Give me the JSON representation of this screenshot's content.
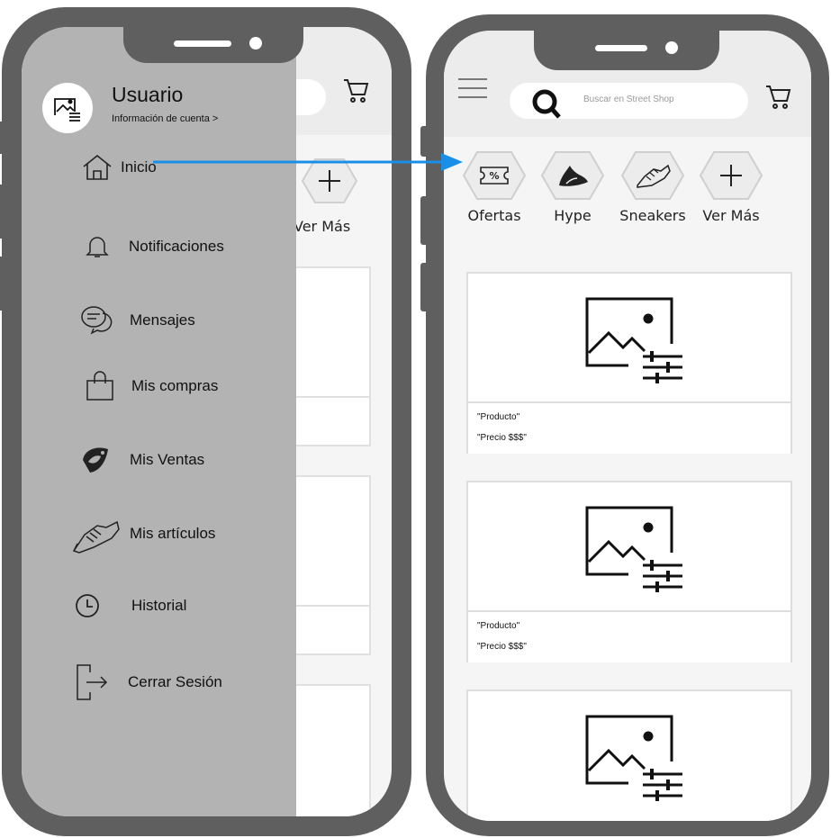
{
  "drawer": {
    "user_name": "Usuario",
    "account_link": "Información de cuenta >",
    "items": [
      {
        "label": "Inicio",
        "icon": "home-icon"
      },
      {
        "label": "Notificaciones",
        "icon": "bell-icon"
      },
      {
        "label": "Mensajes",
        "icon": "chat-icon"
      },
      {
        "label": "Mis compras",
        "icon": "shopping-bag-icon"
      },
      {
        "label": "Mis Ventas",
        "icon": "sales-tag-icon"
      },
      {
        "label": "Mis artículos",
        "icon": "sneaker-icon"
      },
      {
        "label": "Historial",
        "icon": "clock-icon"
      },
      {
        "label": "Cerrar Sesión",
        "icon": "logout-icon"
      }
    ]
  },
  "background_peek": {
    "ver_mas": "Ver Más"
  },
  "home": {
    "search": {
      "placeholder": "Buscar en Street Shop"
    },
    "categories": [
      {
        "label": "Ofertas",
        "icon": "discount-ticket-icon"
      },
      {
        "label": "Hype",
        "icon": "hype-icon"
      },
      {
        "label": "Sneakers",
        "icon": "sneaker-icon"
      },
      {
        "label": "Ver Más",
        "icon": "plus-icon"
      }
    ],
    "products": [
      {
        "name": "\"Producto\"",
        "price": "\"Precio $$$\""
      },
      {
        "name": "\"Producto\"",
        "price": "\"Precio $$$\""
      },
      {
        "name": "",
        "price": ""
      }
    ]
  },
  "colors": {
    "frame": "#5f5f5f",
    "drawer": "#b3b3b3",
    "arrow": "#1a8fe8",
    "screen": "#f5f5f5"
  }
}
